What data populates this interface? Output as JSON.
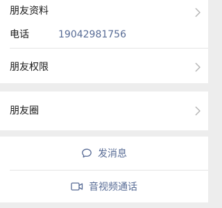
{
  "profile_section": {
    "friend_info_label": "朋友资料",
    "phone_label": "电话",
    "phone_value": "19042981756"
  },
  "permissions_section": {
    "label": "朋友权限"
  },
  "moments_section": {
    "label": "朋友圈"
  },
  "actions": {
    "send_message_label": "发消息",
    "video_call_label": "音视频通话"
  },
  "colors": {
    "link": "#576b95",
    "background": "#ededed",
    "card": "#ffffff"
  },
  "icons": {
    "chevron": "chevron-right-icon",
    "message": "message-bubble-icon",
    "video": "video-camera-icon"
  }
}
